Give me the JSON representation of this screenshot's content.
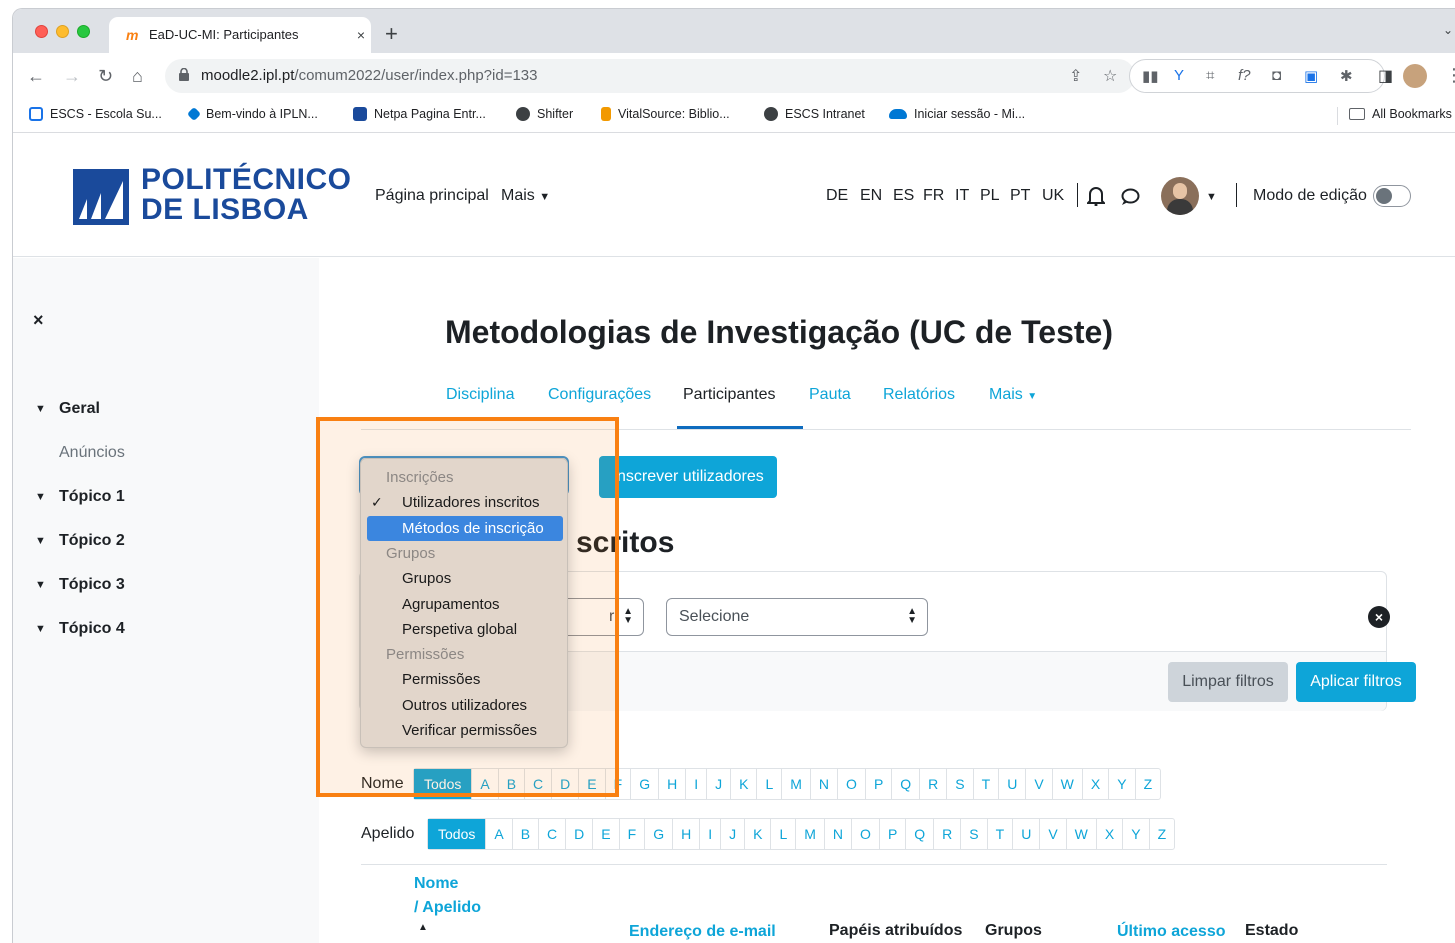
{
  "browser": {
    "tab_title": "EaD-UC-MI: Participantes",
    "tab_close": "×",
    "new_tab": "+",
    "url_host": "moodle2.ipl.pt",
    "url_path": "/comum2022/user/index.php?id=133",
    "bookmarks": [
      {
        "label": "ESCS - Escola Su...",
        "color": "#1a73e8"
      },
      {
        "label": "Bem-vindo à IPLN...",
        "color": "#0078d4"
      },
      {
        "label": "Netpa Pagina Entr...",
        "color": "#1a4a9b"
      },
      {
        "label": "Shifter",
        "color": "#3c4043"
      },
      {
        "label": "VitalSource: Biblio...",
        "color": "#f29900"
      },
      {
        "label": "ESCS Intranet",
        "color": "#3c4043"
      },
      {
        "label": "Iniciar sessão - Mi...",
        "color": "#0078d4"
      }
    ],
    "all_bookmarks": "All Bookmarks"
  },
  "site": {
    "logo_line1": "POLITÉCNICO",
    "logo_line2": "DE LISBOA",
    "nav_home": "Página principal",
    "nav_more": "Mais",
    "languages": [
      "DE",
      "EN",
      "ES",
      "FR",
      "IT",
      "PL",
      "PT",
      "UK"
    ],
    "edit_mode": "Modo de edição"
  },
  "sidebar": {
    "close": "×",
    "sections": [
      {
        "label": "Geral"
      },
      {
        "label": "Tópico 1"
      },
      {
        "label": "Tópico 2"
      },
      {
        "label": "Tópico 3"
      },
      {
        "label": "Tópico 4"
      }
    ],
    "sub_item": "Anúncios"
  },
  "course": {
    "title": "Metodologias de Investigação (UC de Teste)",
    "tabs": [
      {
        "label": "Disciplina"
      },
      {
        "label": "Configurações"
      },
      {
        "label": "Participantes"
      },
      {
        "label": "Pauta"
      },
      {
        "label": "Relatórios"
      },
      {
        "label": "Mais"
      }
    ],
    "active_tab": "Participantes"
  },
  "participants": {
    "enrol_button": "nscrever utilizadores",
    "heading_visible": "scritos",
    "filter_value": "Selecione",
    "filter_small_glyph": "r",
    "clear_filters": "Limpar filtros",
    "apply_filters": "Aplicar filtros",
    "first_name_label": "Nome",
    "last_name_label": "Apelido",
    "all_label": "Todos",
    "letters": [
      "A",
      "B",
      "C",
      "D",
      "E",
      "F",
      "G",
      "H",
      "I",
      "J",
      "K",
      "L",
      "M",
      "N",
      "O",
      "P",
      "Q",
      "R",
      "S",
      "T",
      "U",
      "V",
      "W",
      "X",
      "Y",
      "Z"
    ],
    "columns": {
      "name": "Nome",
      "surname": "/ Apelido",
      "email": "Endereço de e-mail",
      "roles": "Papéis atribuídos",
      "groups": "Grupos",
      "last_access": "Último acesso",
      "status": "Estado"
    }
  },
  "dropdown": {
    "items": [
      {
        "type": "group",
        "label": "Inscrições"
      },
      {
        "type": "option",
        "label": "Utilizadores inscritos",
        "checked": true
      },
      {
        "type": "option",
        "label": "Métodos de inscrição",
        "highlighted": true
      },
      {
        "type": "group",
        "label": "Grupos"
      },
      {
        "type": "option",
        "label": "Grupos"
      },
      {
        "type": "option",
        "label": "Agrupamentos"
      },
      {
        "type": "option",
        "label": "Perspetiva global"
      },
      {
        "type": "group",
        "label": "Permissões"
      },
      {
        "type": "option",
        "label": "Permissões"
      },
      {
        "type": "option",
        "label": "Outros utilizadores"
      },
      {
        "type": "option",
        "label": "Verificar permissões"
      }
    ]
  },
  "colors": {
    "accent": "#0ea5d8",
    "highlight": "#f98012",
    "logo": "#1a4a9b"
  }
}
